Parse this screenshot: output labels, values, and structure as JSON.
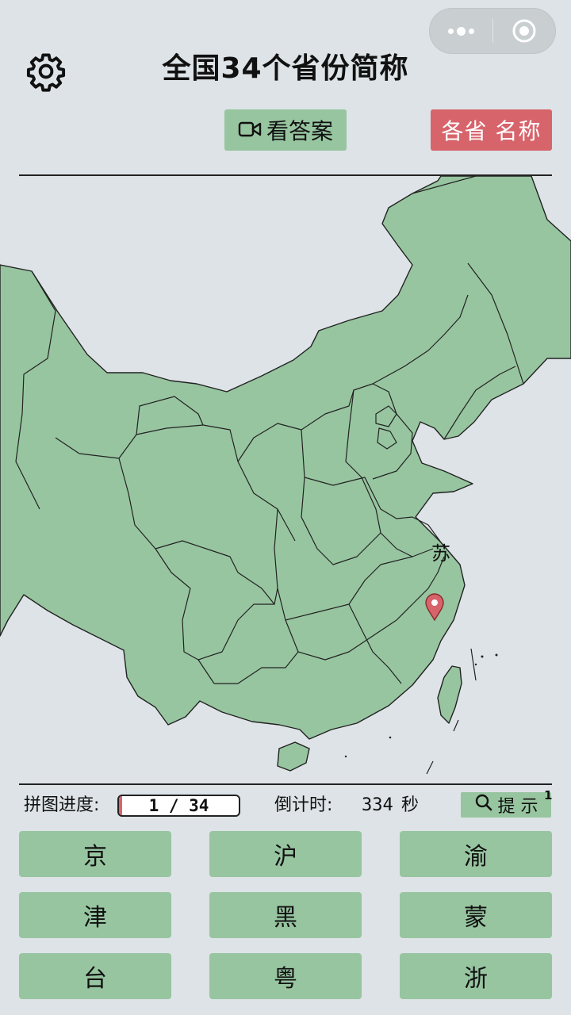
{
  "app": {
    "title": "全国34个省份简称"
  },
  "toolbar": {
    "answer_label": "看答案",
    "names_label": "各省 名称"
  },
  "map": {
    "placed_label": "苏",
    "accent_color": "#d7646b",
    "land_color": "#97c5a0",
    "sea_color": "#dde3e6"
  },
  "status": {
    "progress_label": "拼图进度:",
    "progress_text": "1 / 34",
    "progress_current": 1,
    "progress_total": 34,
    "timer_label": "倒计时:",
    "timer_value": "334",
    "timer_unit": "秒",
    "hint_label": "提 示",
    "hint_count": "1"
  },
  "tiles": [
    "京",
    "沪",
    "渝",
    "津",
    "黑",
    "蒙",
    "台",
    "粤",
    "浙"
  ],
  "icons": {
    "settings": "gear-icon",
    "video": "video-camera-icon",
    "search": "search-icon",
    "pin": "map-pin-icon"
  }
}
